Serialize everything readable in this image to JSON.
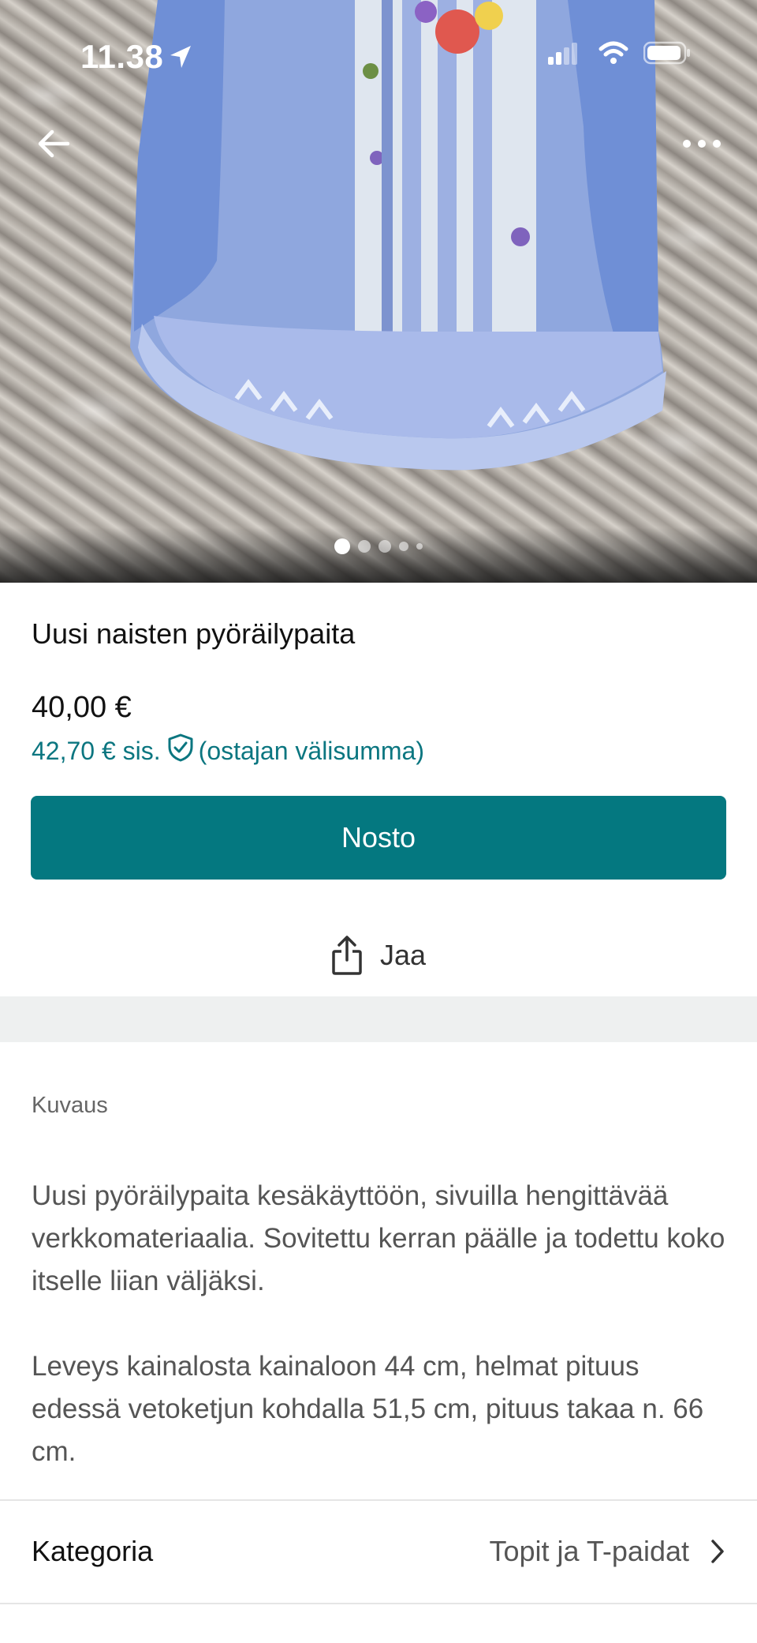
{
  "status_bar": {
    "time": "11.38",
    "icons": [
      "location-arrow-icon",
      "signal-icon",
      "wifi-icon",
      "battery-icon"
    ]
  },
  "nav": {
    "back_icon": "arrow-left-icon",
    "more_icon": "more-dots-icon"
  },
  "gallery": {
    "image_count": 5,
    "active_index": 0
  },
  "listing": {
    "title": "Uusi naisten pyöräilypaita",
    "price": "40,00 €",
    "price_incl_prefix": "42,70 € sis.",
    "price_incl_suffix": "(ostajan välisumma)"
  },
  "actions": {
    "buy_label": "Nosto",
    "share_label": "Jaa"
  },
  "description": {
    "section_label": "Kuvaus",
    "paragraphs": [
      "Uusi pyöräilypaita kesäkäyttöön, sivuilla hengittävää verkkomateriaalia. Sovitettu kerran päälle ja todettu koko itselle liian väljäksi.",
      "Leveys kainalosta kainaloon 44 cm, helmat pituus edessä vetoketjun kohdalla 51,5 cm, pituus takaa n. 66 cm."
    ]
  },
  "details": {
    "category_label": "Kategoria",
    "category_value": "Topit ja T-paidat"
  },
  "colors": {
    "accent": "#047880",
    "accent_text": "#0b7680",
    "band": "#eef0f0"
  }
}
